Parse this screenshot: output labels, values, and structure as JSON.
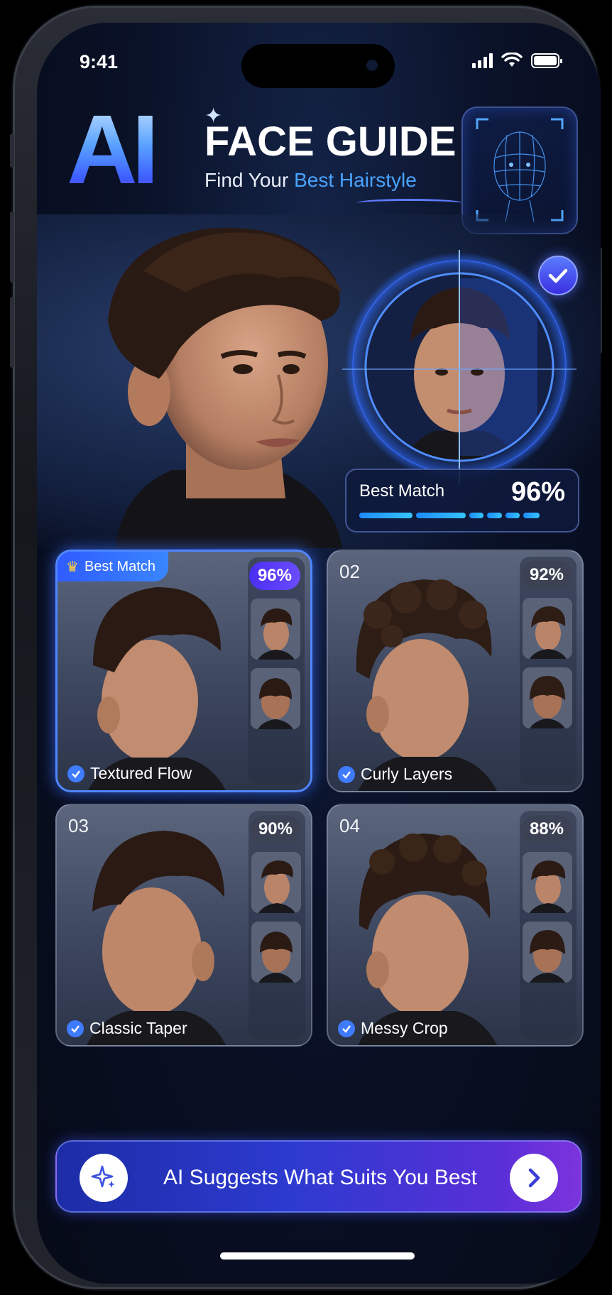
{
  "status_bar": {
    "time": "9:41"
  },
  "header": {
    "logo": "AI",
    "title": "FACE GUIDE",
    "subtitle_prefix": "Find Your ",
    "subtitle_accent": "Best Hairstyle"
  },
  "best_match": {
    "label": "Best Match",
    "percent": "96%",
    "progress": 0.96
  },
  "styles": [
    {
      "number": "",
      "name": "Textured Flow",
      "percent": "96%",
      "tag": "Best Match"
    },
    {
      "number": "02",
      "name": "Curly Layers",
      "percent": "92%"
    },
    {
      "number": "03",
      "name": "Classic Taper",
      "percent": "90%"
    },
    {
      "number": "04",
      "name": "Messy Crop",
      "percent": "88%"
    }
  ],
  "cta": {
    "label": "AI Suggests What Suits You Best"
  },
  "colors": {
    "accent": "#3f7bff",
    "brand_gradient_start": "#2d3ad0",
    "brand_gradient_end": "#7c34dc"
  }
}
